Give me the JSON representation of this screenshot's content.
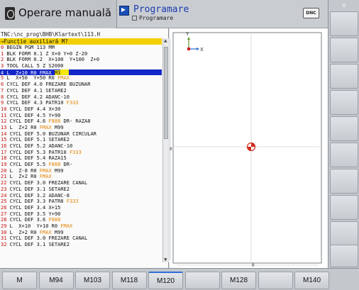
{
  "header": {
    "mode_title": "Operare manuală",
    "program_title": "Programare",
    "program_subtitle": "Programare",
    "dnc_label": "DNC"
  },
  "right_column": {
    "top_label": "0"
  },
  "editor": {
    "path": "TNC:\\nc_prog\\BHB\\Klartext\\113.H",
    "hint": "→Funcție auxiliară M?",
    "lines": [
      {
        "n": "0",
        "t": " BEGIN PGM 113 MM"
      },
      {
        "n": "1",
        "t": " BLK FORM 0.1 Z X+0 Y+0 Z-20"
      },
      {
        "n": "2",
        "t": " BLK FORM 0.2  X+100  Y+100  Z+0"
      },
      {
        "n": "3",
        "t": " TOOL CALL 5 Z S2000"
      },
      {
        "n": "4",
        "t": " L  Z+10 R0 FMAX ",
        "hl": "M3",
        "selected": true
      },
      {
        "n": "5",
        "t": " L  X+50  Y+50 R0 ",
        "o": "FMAX"
      },
      {
        "n": "6",
        "t": " CYCL DEF 4.0 FREZARE BUZUNAR"
      },
      {
        "n": "7",
        "t": " CYCL DEF 4.1 SETARE2"
      },
      {
        "n": "8",
        "t": " CYCL DEF 4.2 ADANC-10"
      },
      {
        "n": "9",
        "t": " CYCL DEF 4.3 PATR10 ",
        "o": "F333"
      },
      {
        "n": "10",
        "t": " CYCL DEF 4.4 X+30"
      },
      {
        "n": "11",
        "t": " CYCL DEF 4.5 Y+90"
      },
      {
        "n": "12",
        "t": " CYCL DEF 4.6 ",
        "o": "F888",
        "t2": " DR- RAZA8"
      },
      {
        "n": "13",
        "t": " L  Z+2 R0 ",
        "o": "FMAX",
        "t2": " M99"
      },
      {
        "n": "14",
        "t": " CYCL DEF 5.0 BUZUNAR CIRCULAR"
      },
      {
        "n": "15",
        "t": " CYCL DEF 5.1 SETARE2"
      },
      {
        "n": "16",
        "t": " CYCL DEF 5.2 ADANC-10"
      },
      {
        "n": "17",
        "t": " CYCL DEF 5.3 PATR10 ",
        "o": "F333"
      },
      {
        "n": "18",
        "t": " CYCL DEF 5.4 RAZA15"
      },
      {
        "n": "19",
        "t": " CYCL DEF 5.5 ",
        "o": "F888",
        "t2": " DR-"
      },
      {
        "n": "20",
        "t": " L  Z-8 R0 ",
        "o": "FMAX",
        "t2": " M99"
      },
      {
        "n": "21",
        "t": " L  Z+2 R0 ",
        "o": "FMAX"
      },
      {
        "n": "22",
        "t": " CYCL DEF 3.0 FREZARE CANAL"
      },
      {
        "n": "23",
        "t": " CYCL DEF 3.1 SETARE2"
      },
      {
        "n": "24",
        "t": " CYCL DEF 3.2 ADANC-8"
      },
      {
        "n": "25",
        "t": " CYCL DEF 3.3 PATR8 ",
        "o": "F333"
      },
      {
        "n": "26",
        "t": " CYCL DEF 3.4 X+15"
      },
      {
        "n": "27",
        "t": " CYCL DEF 3.5 Y+90"
      },
      {
        "n": "28",
        "t": " CYCL DEF 3.6 ",
        "o": "F888"
      },
      {
        "n": "29",
        "t": " L  X+10  Y+10 R0 ",
        "o": "FMAX"
      },
      {
        "n": "30",
        "t": " L  Z+2 R0 ",
        "o": "FMAX",
        "t2": " M99"
      },
      {
        "n": "31",
        "t": " CYCL DEF 3.0 FREZARE CANAL"
      },
      {
        "n": "32",
        "t": " CYCL DEF 3.1 SETARE2"
      }
    ]
  },
  "graphics": {
    "axis_y": "Y",
    "axis_x": "X",
    "left_scale_label": "0",
    "bottom_scale_label": "0"
  },
  "softkeys": [
    "M",
    "M94",
    "M103",
    "M118",
    "M120",
    "",
    "M128",
    "",
    "M140"
  ],
  "colors": {
    "selection": "#1426c8",
    "highlight": "#f4e70d",
    "line_number": "#c8100c",
    "feed_keyword": "#e08400",
    "hint_bar": "#f2d000"
  }
}
